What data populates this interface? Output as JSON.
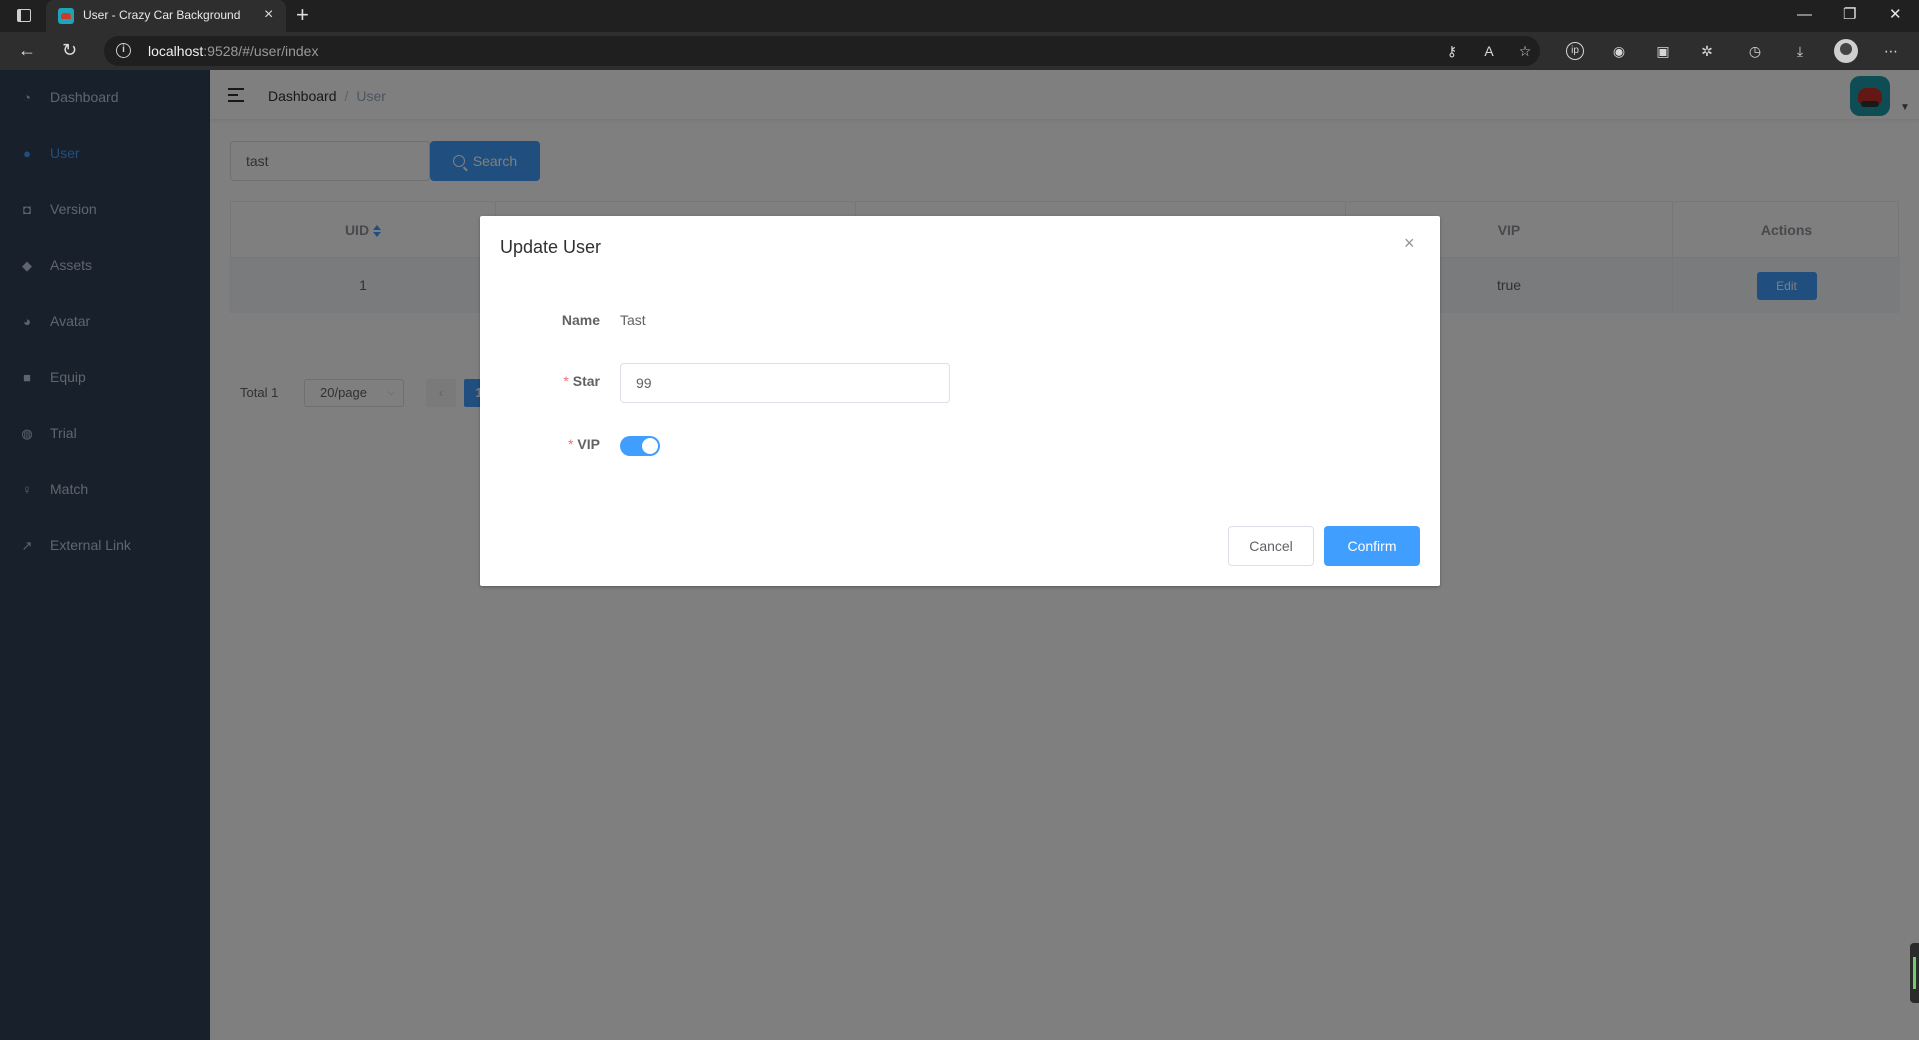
{
  "browser": {
    "tab_title": "User - Crazy Car Background",
    "url_host": "localhost",
    "url_path": ":9528/#/user/index"
  },
  "sidebar": {
    "items": [
      {
        "label": "Dashboard",
        "icon": "dashboard-icon"
      },
      {
        "label": "User",
        "icon": "user-icon",
        "active": true
      },
      {
        "label": "Version",
        "icon": "version-icon"
      },
      {
        "label": "Assets",
        "icon": "assets-icon"
      },
      {
        "label": "Avatar",
        "icon": "avatar-icon"
      },
      {
        "label": "Equip",
        "icon": "equip-icon"
      },
      {
        "label": "Trial",
        "icon": "trial-icon"
      },
      {
        "label": "Match",
        "icon": "match-icon"
      },
      {
        "label": "External Link",
        "icon": "external-link-icon"
      }
    ]
  },
  "breadcrumb": {
    "home": "Dashboard",
    "separator": "/",
    "current": "User"
  },
  "search": {
    "value": "tast",
    "button_label": "Search"
  },
  "table": {
    "headers": [
      "UID",
      "",
      "",
      "VIP",
      "Actions"
    ],
    "rows": [
      {
        "uid": "1",
        "vip": "true",
        "action": "Edit"
      }
    ]
  },
  "pagination": {
    "total": "Total 1",
    "page_size": "20/page",
    "current_page": "1"
  },
  "dialog": {
    "title": "Update User",
    "name_label": "Name",
    "name_value": "Tast",
    "star_label": "Star",
    "star_value": "99",
    "vip_label": "VIP",
    "vip_on": true,
    "required_mark": "*",
    "cancel_label": "Cancel",
    "confirm_label": "Confirm"
  },
  "colors": {
    "primary": "#409eff",
    "sidebar_bg": "#304156",
    "sidebar_text": "#bfcbd9"
  }
}
